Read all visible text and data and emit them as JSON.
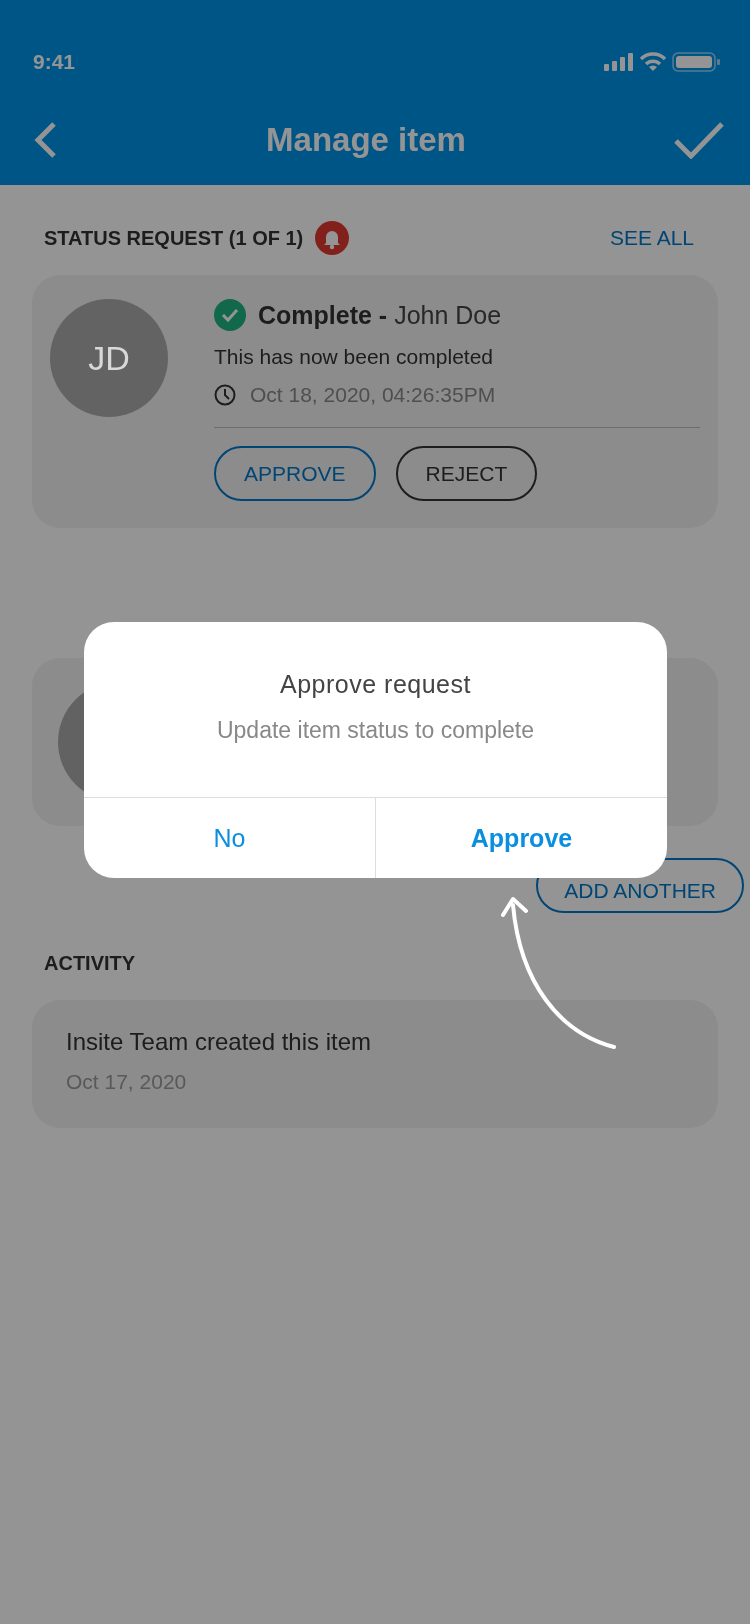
{
  "status_bar": {
    "time": "9:41"
  },
  "nav": {
    "title": "Manage item"
  },
  "status_request": {
    "title": "STATUS REQUEST (1 OF 1)",
    "see_all": "SEE ALL",
    "card": {
      "initials": "JD",
      "status": "Complete -",
      "author": "John Doe",
      "message": "This has now been completed",
      "timestamp": "Oct 18, 2020, 04:26:35PM",
      "actions": [
        {
          "label": "APPROVE",
          "kind": "primary"
        },
        {
          "label": "REJECT",
          "kind": "secondary"
        }
      ]
    }
  },
  "comments": {
    "add_button": "ADD ANOTHER"
  },
  "activity": {
    "title": "ACTIVITY",
    "items": [
      {
        "text": "Insite Team created this item",
        "date": "Oct 17, 2020"
      }
    ]
  },
  "dialog": {
    "title": "Approve request",
    "message": "Update item status to complete",
    "buttons": [
      {
        "label": "No",
        "kind": "cancel"
      },
      {
        "label": "Approve",
        "kind": "confirm"
      }
    ]
  }
}
